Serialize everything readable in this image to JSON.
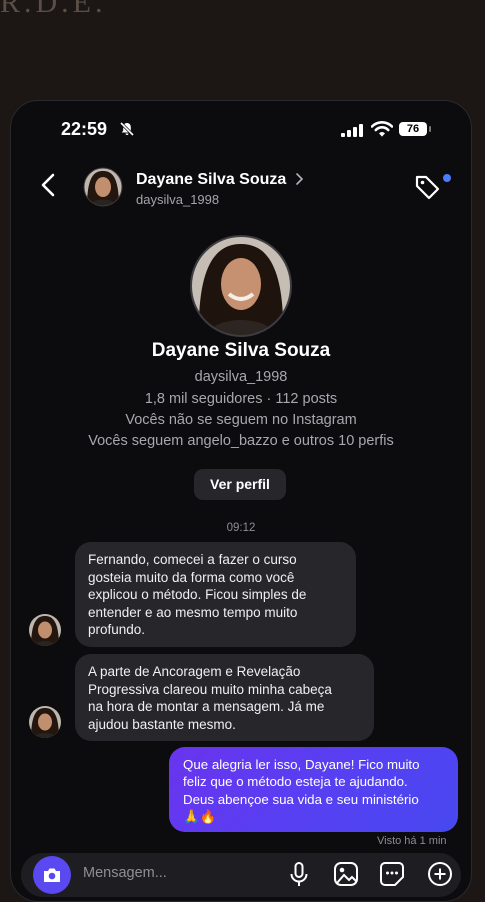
{
  "watermark": "R.D.E.",
  "status_bar": {
    "time": "22:59",
    "battery": "76"
  },
  "header": {
    "name": "Dayane Silva Souza",
    "username": "daysilva_1998"
  },
  "profile": {
    "name": "Dayane Silva Souza",
    "username": "daysilva_1998",
    "stats": "1,8 mil seguidores · 112 posts",
    "follow_status": "Vocês não se seguem no Instagram",
    "mutuals": "Vocês seguem angelo_bazzo e outros 10 perfis",
    "view_profile_label": "Ver perfil"
  },
  "chat": {
    "timestamp": "09:12",
    "messages": [
      {
        "sender": "Dayane Silva Souza",
        "lines": [
          "Fernando, comecei a fazer o curso",
          "gosteia muito da forma como você",
          "explicou o método. Ficou simples de",
          "entender e ao mesmo tempo muito",
          "profundo."
        ]
      },
      {
        "sender": "Dayane Silva Souza",
        "lines": [
          "A parte de Ancoragem e Revelação",
          "Progressiva clareou muito minha cabeça",
          "na hora de montar a mensagem. Já me",
          "ajudou bastante mesmo."
        ]
      },
      {
        "sender": "me",
        "lines": [
          "Que alegria ler isso, Dayane! Fico muito",
          "feliz que o método esteja te ajudando.",
          "Deus abençoe sua vida e seu ministério",
          "🙏🔥"
        ]
      }
    ],
    "seen": "Visto há 1 min"
  },
  "composer": {
    "placeholder": "Mensagem..."
  },
  "colors": {
    "background": "#1c1614",
    "phone_bg": "#0c0c0f",
    "incoming_bubble": "#26262b",
    "outgoing_bubble": "#5a3ff0",
    "camera_button": "#5a48f0",
    "notification_dot": "#4b7bff"
  },
  "icons": [
    "mute-bell-icon",
    "signal-icon",
    "wifi-icon",
    "battery-icon",
    "back-chevron-icon",
    "chevron-right-icon",
    "tag-icon",
    "camera-icon",
    "microphone-icon",
    "image-icon",
    "sticker-icon",
    "plus-icon"
  ]
}
